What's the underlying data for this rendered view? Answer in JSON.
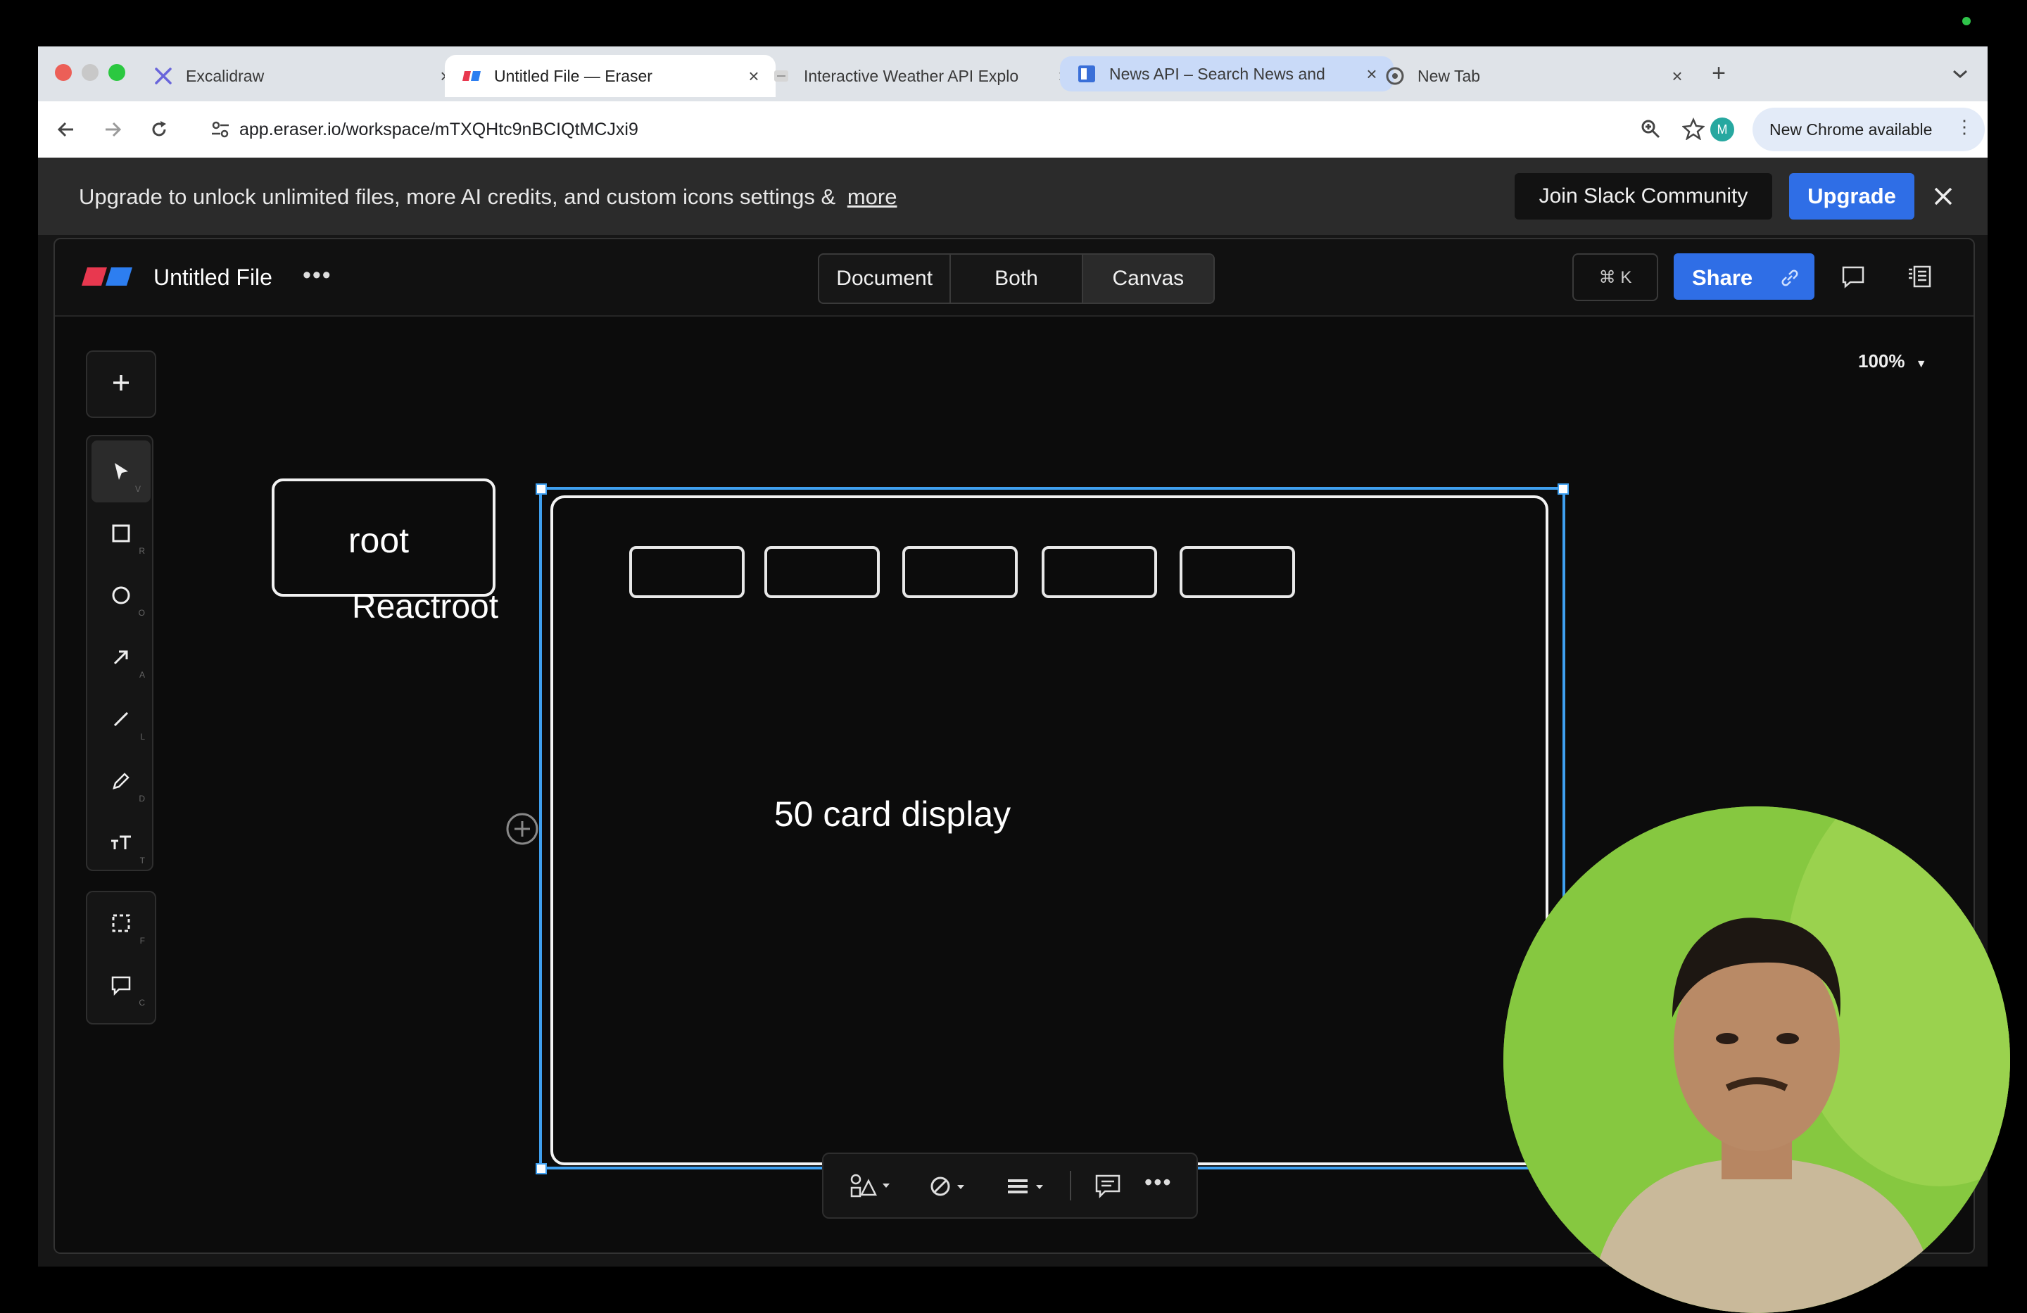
{
  "browser": {
    "tabs": [
      {
        "title": "Excalidraw",
        "icon": "excalidraw-icon"
      },
      {
        "title": "Untitled File — Eraser",
        "icon": "eraser-icon",
        "active": true
      },
      {
        "title": "Interactive Weather API Explo",
        "icon": "page-icon"
      },
      {
        "title": "News API – Search News and",
        "icon": "news-api-icon",
        "highlighted": true
      },
      {
        "title": "New Tab",
        "icon": "chrome-icon"
      }
    ],
    "url": "app.eraser.io/workspace/mTXQHtc9nBCIQtMCJxi9",
    "profile_initial": "M",
    "update_label": "New Chrome available"
  },
  "banner": {
    "text": "Upgrade to unlock unlimited files, more AI credits, and custom icons settings &",
    "more_link": "more",
    "join_slack": "Join Slack Community",
    "upgrade": "Upgrade"
  },
  "editor": {
    "file_title": "Untitled File",
    "views": [
      "Document",
      "Both",
      "Canvas"
    ],
    "active_view": "Canvas",
    "command_shortcut": "⌘ K",
    "share": "Share",
    "zoom": "100%"
  },
  "canvas": {
    "root_label": "root",
    "reactroot_label": "Reactroot",
    "frame_label": "50 card display"
  },
  "colors": {
    "accent": "#2f6ee6",
    "selection": "#3fa0f0",
    "canvas_bg": "#0c0c0c",
    "banner_bg": "#2b2b2b"
  }
}
